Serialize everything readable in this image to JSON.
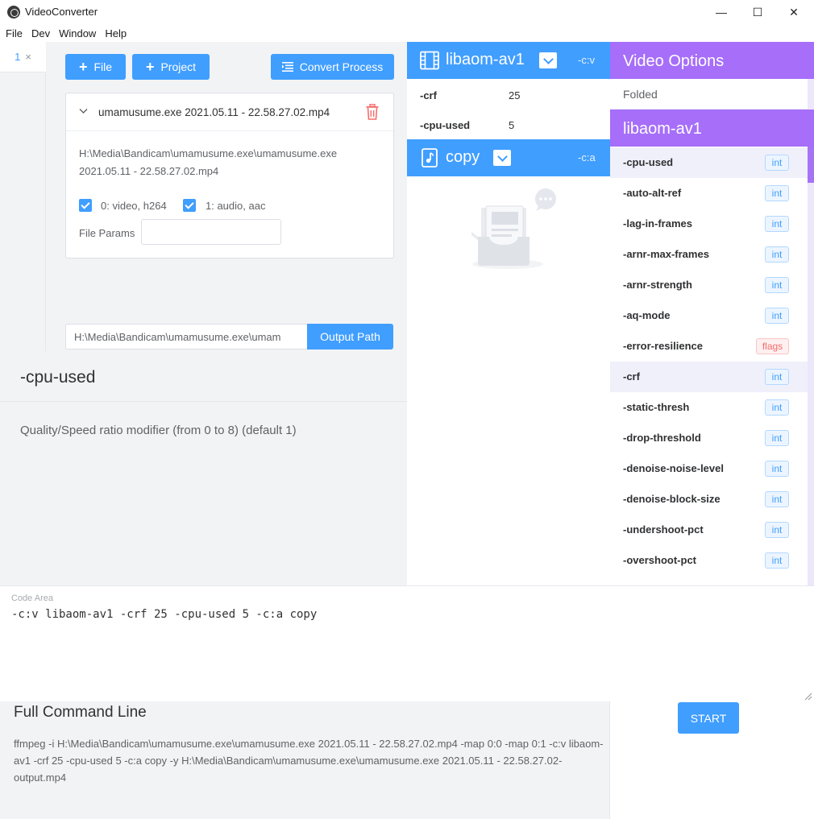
{
  "window": {
    "title": "VideoConverter",
    "controls": {
      "minimize": "—",
      "maximize": "☐",
      "close": "✕"
    }
  },
  "menu": [
    "File",
    "Dev",
    "Window",
    "Help"
  ],
  "tabs": [
    {
      "label": "1",
      "close": "×"
    }
  ],
  "toolbar": {
    "add_file": "File",
    "add_project": "Project",
    "convert_process": "Convert Process"
  },
  "file_card": {
    "name": "umamusume.exe 2021.05.11 - 22.58.27.02.mp4",
    "path": "H:\\Media\\Bandicam\\umamusume.exe\\umamusume.exe 2021.05.11 - 22.58.27.02.mp4",
    "streams": [
      {
        "label": "0: video, h264",
        "checked": true
      },
      {
        "label": "1: audio, aac",
        "checked": true
      }
    ],
    "params_label": "File Params",
    "params_value": ""
  },
  "output": {
    "path": "H:\\Media\\Bandicam\\umamusume.exe\\umam",
    "button": "Output Path"
  },
  "help": {
    "title": "-cpu-used",
    "description": "Quality/Speed ratio modifier (from 0 to 8) (default 1)"
  },
  "encoders": [
    {
      "name": "libaom-av1",
      "flag": "-c:v",
      "icon": "film-icon",
      "params": [
        {
          "name": "-crf",
          "value": "25"
        },
        {
          "name": "-cpu-used",
          "value": "5"
        }
      ]
    },
    {
      "name": "copy",
      "flag": "-c:a",
      "icon": "music-note-icon",
      "params": []
    }
  ],
  "options_panel": {
    "title": "Video Options",
    "folded": "Folded",
    "library": "libaom-av1",
    "options": [
      {
        "name": "-cpu-used",
        "type": "int",
        "highlighted": true
      },
      {
        "name": "-auto-alt-ref",
        "type": "int",
        "highlighted": false
      },
      {
        "name": "-lag-in-frames",
        "type": "int",
        "highlighted": false
      },
      {
        "name": "-arnr-max-frames",
        "type": "int",
        "highlighted": false
      },
      {
        "name": "-arnr-strength",
        "type": "int",
        "highlighted": false
      },
      {
        "name": "-aq-mode",
        "type": "int",
        "highlighted": false
      },
      {
        "name": "-error-resilience",
        "type": "flags",
        "highlighted": false
      },
      {
        "name": "-crf",
        "type": "int",
        "highlighted": true
      },
      {
        "name": "-static-thresh",
        "type": "int",
        "highlighted": false
      },
      {
        "name": "-drop-threshold",
        "type": "int",
        "highlighted": false
      },
      {
        "name": "-denoise-noise-level",
        "type": "int",
        "highlighted": false
      },
      {
        "name": "-denoise-block-size",
        "type": "int",
        "highlighted": false
      },
      {
        "name": "-undershoot-pct",
        "type": "int",
        "highlighted": false
      },
      {
        "name": "-overshoot-pct",
        "type": "int",
        "highlighted": false
      }
    ]
  },
  "code_area": {
    "label": "Code Area",
    "code": "-c:v libaom-av1 -crf 25 -cpu-used 5 -c:a copy"
  },
  "command": {
    "title": "Full Command Line",
    "text": "ffmpeg -i H:\\Media\\Bandicam\\umamusume.exe\\umamusume.exe 2021.05.11 - 22.58.27.02.mp4 -map 0:0 -map 0:1 -c:v libaom-av1 -crf 25 -cpu-used 5 -c:a copy -y H:\\Media\\Bandicam\\umamusume.exe\\umamusume.exe 2021.05.11 - 22.58.27.02-output.mp4"
  },
  "start_button": "START",
  "colors": {
    "primary": "#409eff",
    "options_header": "#a66ef9",
    "danger": "#f56c6c",
    "panel_bg": "#f2f3f5"
  }
}
